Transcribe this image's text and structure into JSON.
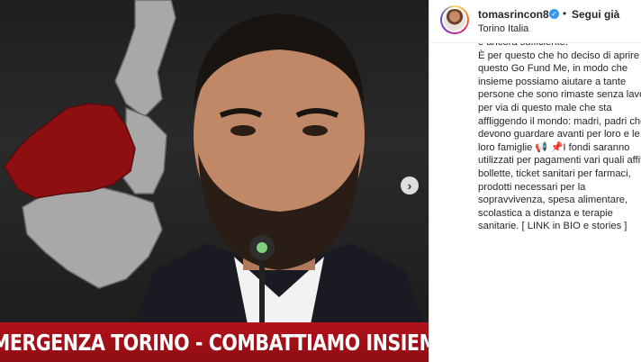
{
  "post": {
    "banner_text": "EMERGENZA TORINO - COMBATTIAMO INSIEME",
    "next_icon": "chevron-right-icon"
  },
  "header": {
    "username": "tomasrincon8",
    "verified_icon": "verified-badge-icon",
    "separator": "•",
    "follow_label": "Segui già",
    "location": "Torino Italia"
  },
  "caption": {
    "lines": [
      "è ancora sufficiente.",
      "È per questo che ho deciso di aprire",
      "questo Go Fund Me, in modo che",
      "insieme possiamo aiutare a tante",
      "persone che sono rimaste senza lavoro",
      "per via di questo male che sta",
      "affliggendo il mondo: madri, padri che",
      "devono guardare avanti per loro e le",
      "loro famiglie 📢 📌I fondi saranno",
      "utilizzati per pagamenti vari quali affitto,",
      "bollette, ticket sanitari per farmaci,",
      "prodotti necessari per la",
      "sopravvivenza, spesa alimentare,",
      "scolastica a distanza e terapie",
      "sanitarie. [ LINK in BIO e stories ]"
    ]
  },
  "colors": {
    "region_highlight": "#8e0f12",
    "region_grey": "#a8a8a8",
    "banner_red": "#b3121a",
    "verified_blue": "#3897f0"
  }
}
